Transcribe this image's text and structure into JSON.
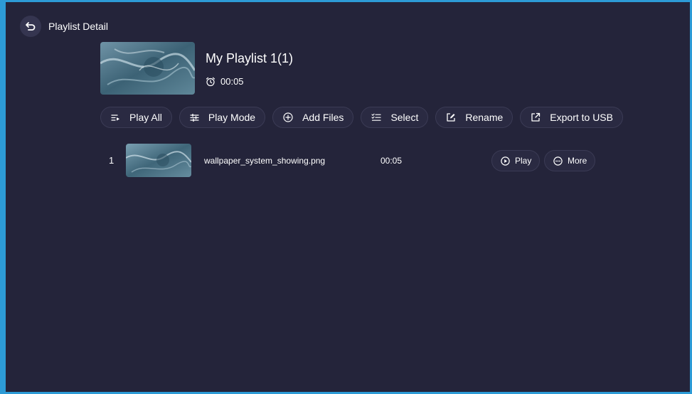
{
  "header": {
    "title": "Playlist Detail",
    "back_icon": "back-arrow-icon"
  },
  "playlist": {
    "name": "My Playlist 1(1)",
    "duration": "00:05"
  },
  "toolbar": {
    "play_all": "Play All",
    "play_mode": "Play Mode",
    "add_files": "Add Files",
    "select": "Select",
    "rename": "Rename",
    "export": "Export to USB"
  },
  "items": [
    {
      "index": "1",
      "name": "wallpaper_system_showing.png",
      "duration": "00:05",
      "play_label": "Play",
      "more_label": "More"
    }
  ],
  "colors": {
    "background": "#24243a",
    "accent_border": "#2d9bd6",
    "button_bg": "#2a2a42"
  }
}
